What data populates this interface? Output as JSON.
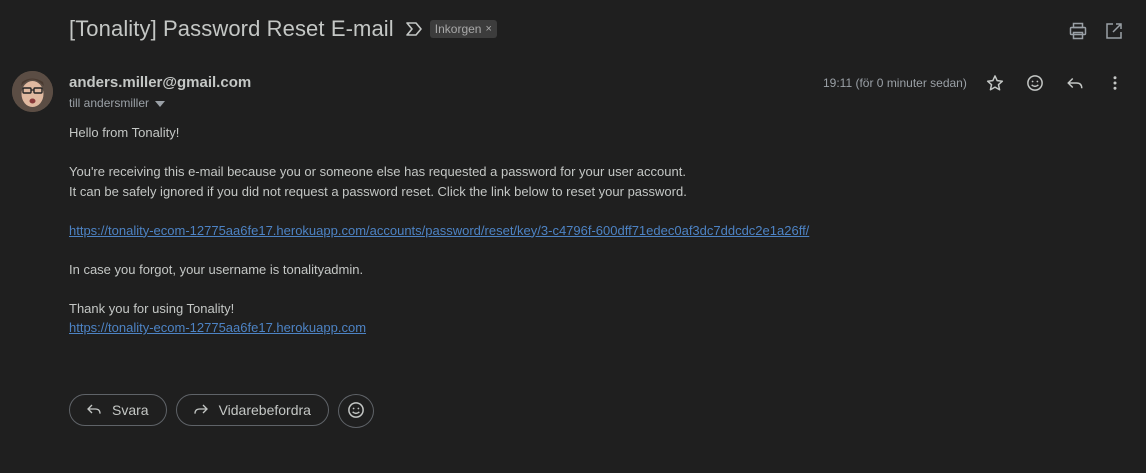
{
  "header": {
    "subject": "[Tonality] Password Reset E-mail",
    "label_chip": "Inkorgen",
    "label_remove": "×",
    "actions": [
      "print-icon",
      "open-in-new-window-icon"
    ]
  },
  "message": {
    "sender": "anders.miller@gmail.com",
    "recipient": "till andersmiller",
    "time": "19:11 (för 0 minuter sedan)",
    "actions": [
      "star-icon",
      "emoji-icon",
      "reply-icon",
      "more-vert-icon"
    ]
  },
  "body": {
    "greeting": "Hello from Tonality!",
    "line1": "You're receiving this e-mail because you or someone else has requested a password for your user account.",
    "line2": "It can be safely ignored if you did not request a password reset. Click the link below to reset your password.",
    "reset_link": "https://tonality-ecom-12775aa6fe17.herokuapp.com/accounts/password/reset/key/3-c4796f-600dff71edec0af3dc7ddcdc2e1a26ff/",
    "username_line": "In case you forgot, your username is tonalityadmin.",
    "thanks": "Thank you for using Tonality!",
    "site_link": "https://tonality-ecom-12775aa6fe17.herokuapp.com"
  },
  "reply_bar": {
    "reply_label": "Svara",
    "forward_label": "Vidarebefordra"
  }
}
